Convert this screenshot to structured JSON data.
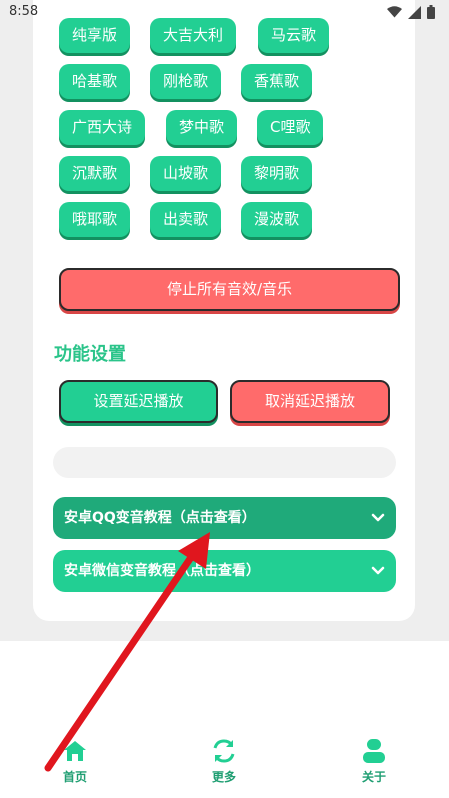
{
  "status_bar": {
    "time": "8:58"
  },
  "sounds": [
    {
      "label": "纯享版"
    },
    {
      "label": "大吉大利"
    },
    {
      "label": "马云歌"
    },
    {
      "label": "哈基歌"
    },
    {
      "label": "刚枪歌"
    },
    {
      "label": "香蕉歌"
    },
    {
      "label": "广西大诗"
    },
    {
      "label": "梦中歌"
    },
    {
      "label": "C哩歌"
    },
    {
      "label": "沉默歌"
    },
    {
      "label": "山坡歌"
    },
    {
      "label": "黎明歌"
    },
    {
      "label": "哦耶歌"
    },
    {
      "label": "出卖歌"
    },
    {
      "label": "漫波歌"
    }
  ],
  "stop_all_label": "停止所有音效/音乐",
  "settings": {
    "title": "功能设置",
    "delay_set_label": "设置延迟播放",
    "delay_cancel_label": "取消延迟播放"
  },
  "tutorials": [
    {
      "label": "安卓QQ变音教程（点击查看）"
    },
    {
      "label": "安卓微信变音教程（点击查看）"
    }
  ],
  "bottom_nav": [
    {
      "label": "首页",
      "icon": "home-icon"
    },
    {
      "label": "更多",
      "icon": "refresh-icon"
    },
    {
      "label": "关于",
      "icon": "user-icon"
    }
  ],
  "colors": {
    "primary": "#22cf93",
    "primary_dark": "#1faa7a",
    "danger": "#ff6b6b",
    "annotation_arrow": "#e0161e"
  }
}
